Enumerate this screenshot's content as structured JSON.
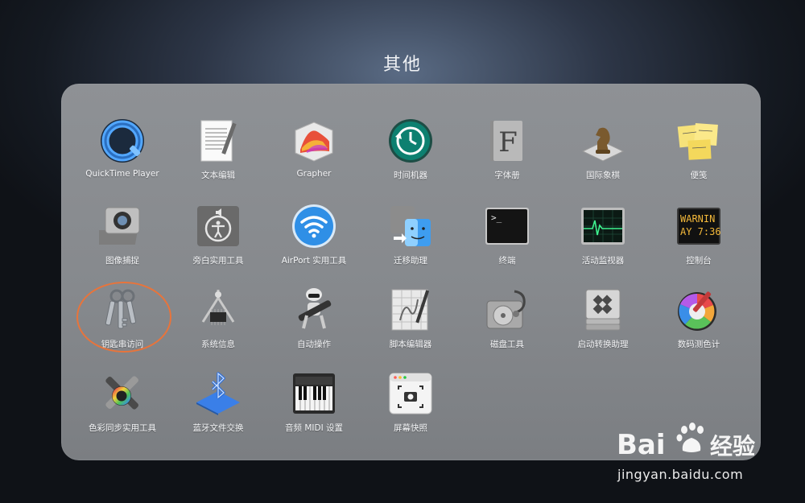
{
  "folder": {
    "title": "其他"
  },
  "apps": [
    {
      "label": "QuickTime Player",
      "icon": "quicktime-icon"
    },
    {
      "label": "文本编辑",
      "icon": "textedit-icon"
    },
    {
      "label": "Grapher",
      "icon": "grapher-icon"
    },
    {
      "label": "时间机器",
      "icon": "time-machine-icon"
    },
    {
      "label": "字体册",
      "icon": "font-book-icon"
    },
    {
      "label": "国际象棋",
      "icon": "chess-icon"
    },
    {
      "label": "便笺",
      "icon": "stickies-icon"
    },
    {
      "label": "图像捕捉",
      "icon": "image-capture-icon"
    },
    {
      "label": "旁白实用工具",
      "icon": "voiceover-utility-icon"
    },
    {
      "label": "AirPort 实用工具",
      "icon": "airport-utility-icon"
    },
    {
      "label": "迁移助理",
      "icon": "migration-assistant-icon"
    },
    {
      "label": "终端",
      "icon": "terminal-icon"
    },
    {
      "label": "活动监视器",
      "icon": "activity-monitor-icon"
    },
    {
      "label": "控制台",
      "icon": "console-icon"
    },
    {
      "label": "钥匙串访问",
      "icon": "keychain-access-icon"
    },
    {
      "label": "系统信息",
      "icon": "system-information-icon"
    },
    {
      "label": "自动操作",
      "icon": "automator-icon"
    },
    {
      "label": "脚本编辑器",
      "icon": "script-editor-icon"
    },
    {
      "label": "磁盘工具",
      "icon": "disk-utility-icon"
    },
    {
      "label": "启动转换助理",
      "icon": "boot-camp-assistant-icon"
    },
    {
      "label": "数码测色计",
      "icon": "digital-color-meter-icon"
    },
    {
      "label": "色彩同步实用工具",
      "icon": "colorsync-utility-icon"
    },
    {
      "label": "蓝牙文件交换",
      "icon": "bluetooth-file-exchange-icon"
    },
    {
      "label": "音频 MIDI 设置",
      "icon": "audio-midi-setup-icon"
    },
    {
      "label": "屏幕快照",
      "icon": "screenshot-icon"
    }
  ],
  "console_icon_text": [
    "WARNIN",
    "AY 7:36"
  ],
  "terminal_icon_text": ">_",
  "font_book_letter": "F",
  "watermark": {
    "logo": "Bai du 经验",
    "url": "jingyan.baidu.com"
  },
  "colors": {
    "highlight": "#e8743b",
    "panel": "#8a8d91"
  }
}
